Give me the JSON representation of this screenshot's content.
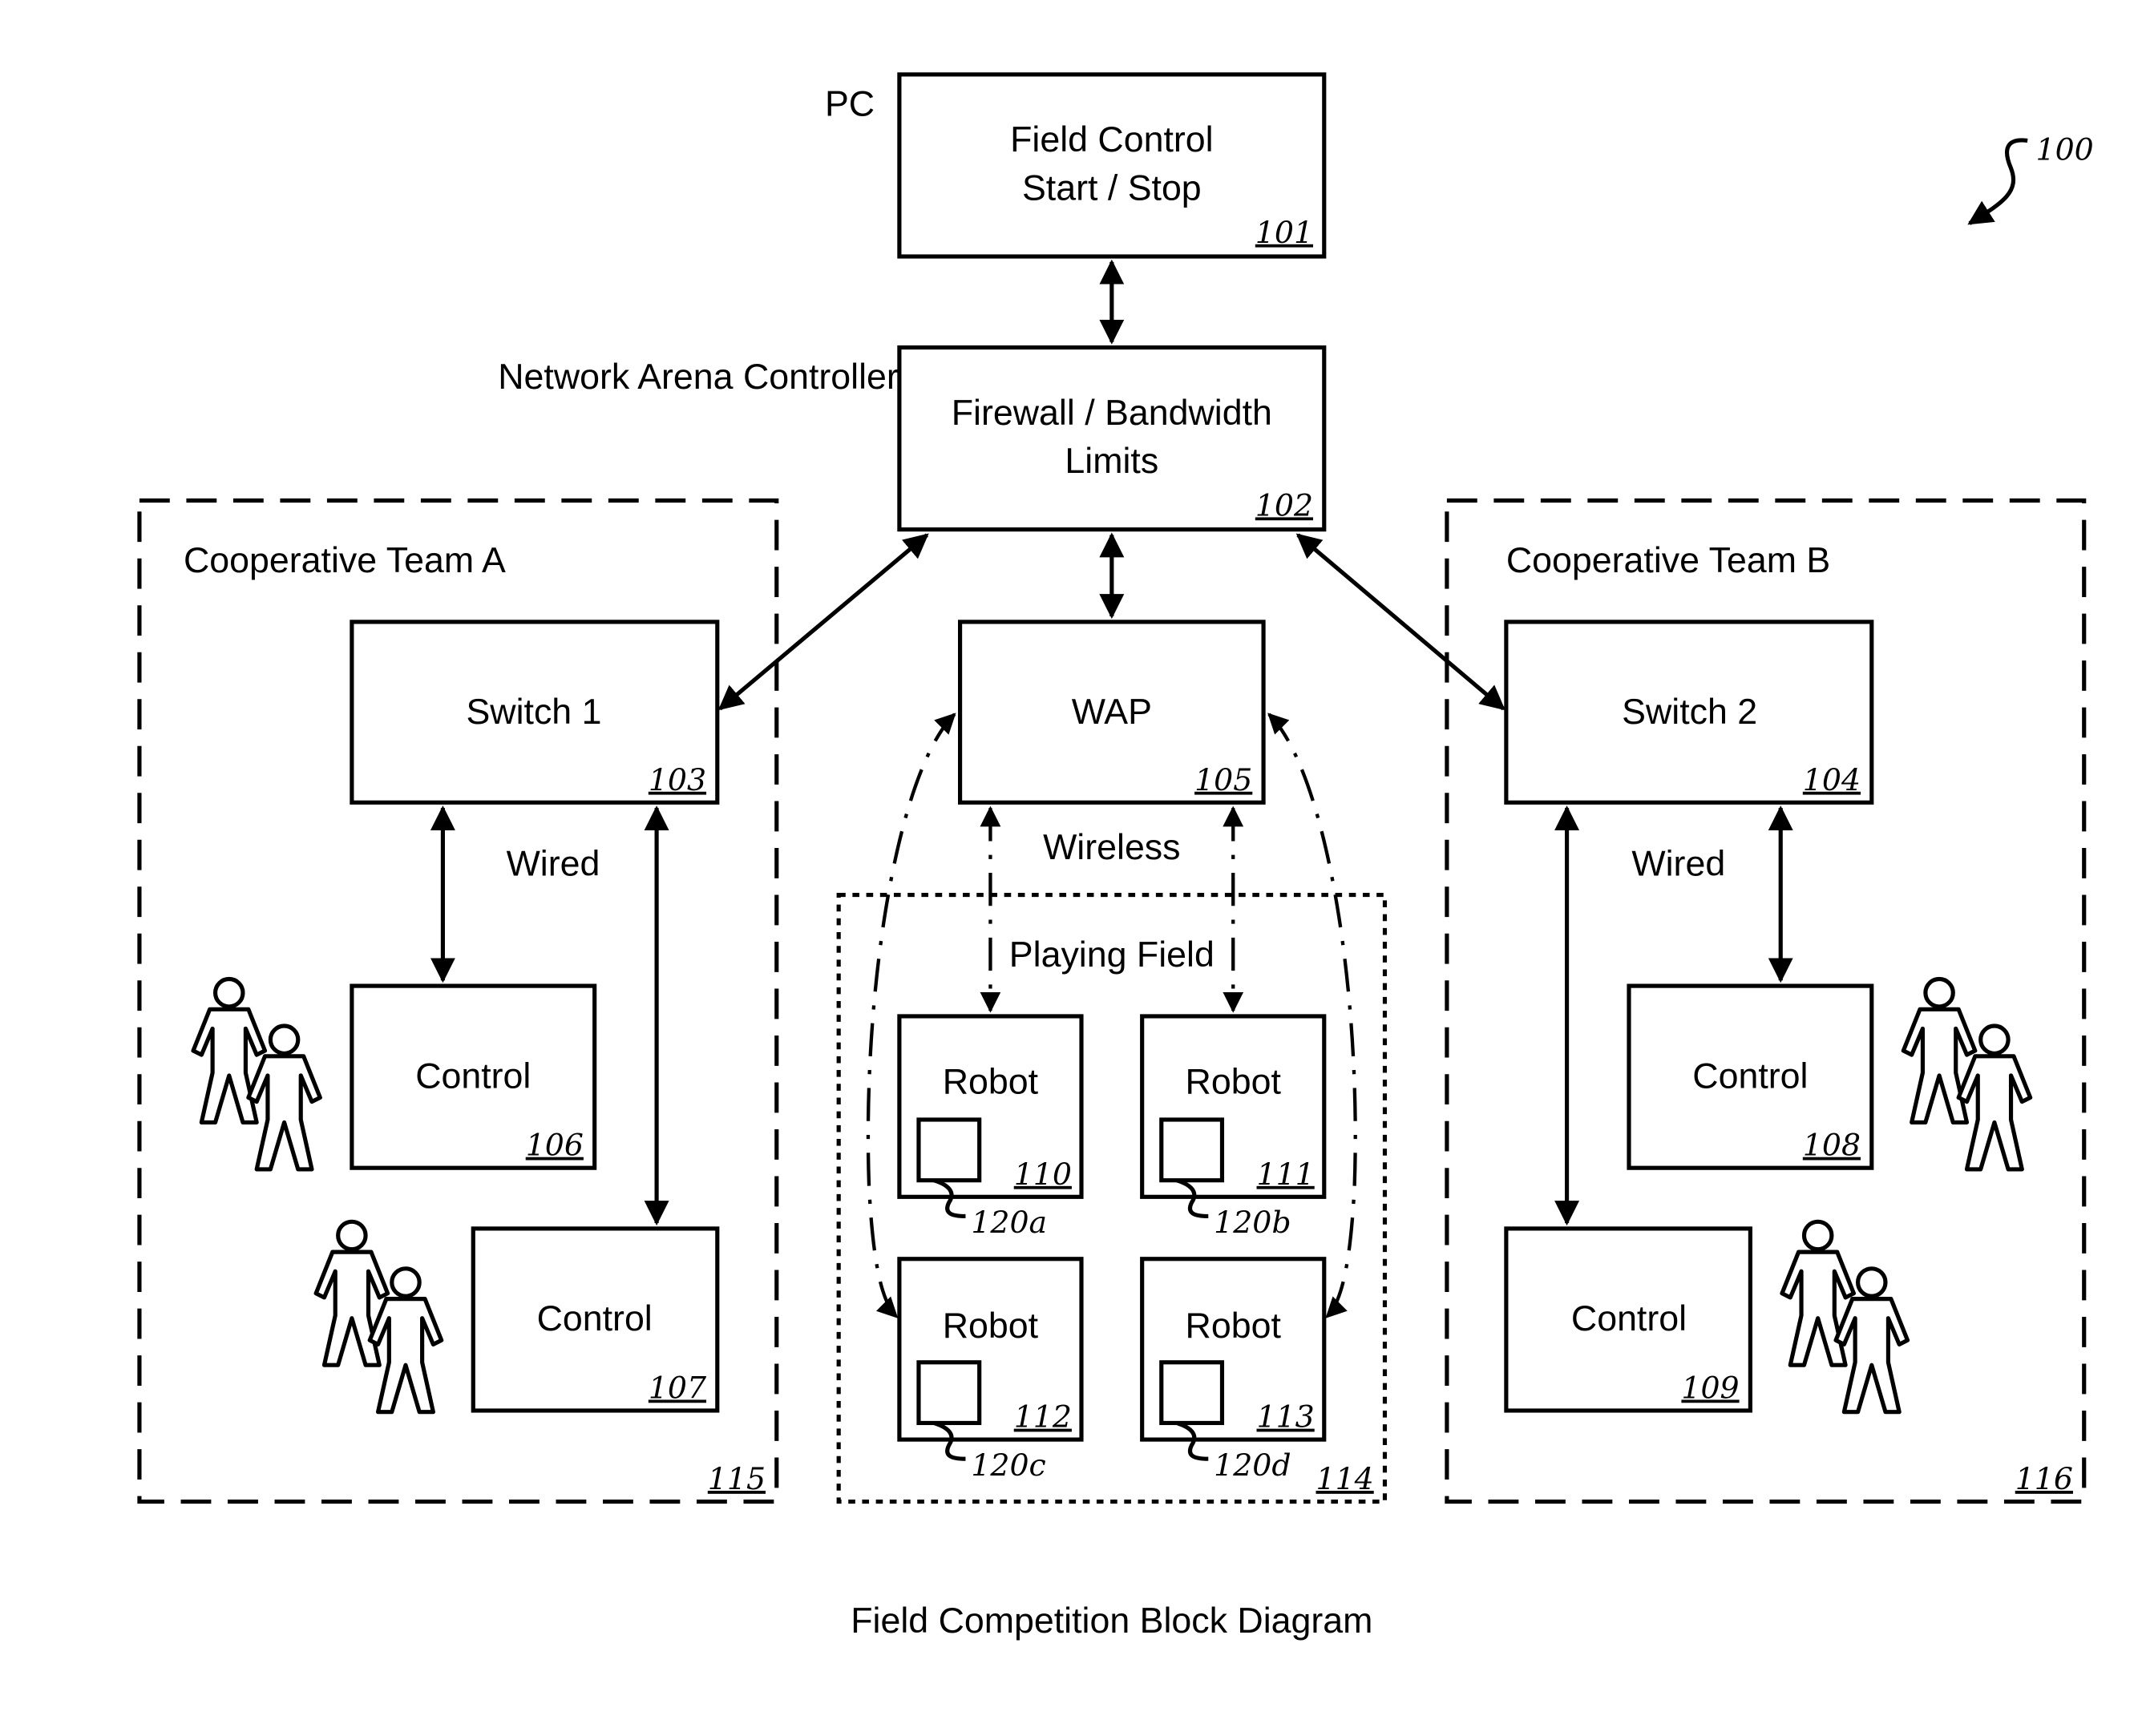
{
  "figure": {
    "ref_label": "100",
    "caption": "Field Competition Block Diagram"
  },
  "nodes": {
    "pc": {
      "side_label": "PC",
      "line1": "Field Control",
      "line2": "Start / Stop",
      "ref": "101"
    },
    "nac": {
      "side_label": "Network Arena Controller",
      "line1": "Firewall / Bandwidth",
      "line2": "Limits",
      "ref": "102"
    },
    "switch1": {
      "label": "Switch 1",
      "ref": "103"
    },
    "switch2": {
      "label": "Switch 2",
      "ref": "104"
    },
    "wap": {
      "label": "WAP",
      "ref": "105"
    },
    "control106": {
      "label": "Control",
      "ref": "106"
    },
    "control107": {
      "label": "Control",
      "ref": "107"
    },
    "control108": {
      "label": "Control",
      "ref": "108"
    },
    "control109": {
      "label": "Control",
      "ref": "109"
    },
    "robot110": {
      "label": "Robot",
      "ref": "110",
      "inner_ref": "120a"
    },
    "robot111": {
      "label": "Robot",
      "ref": "111",
      "inner_ref": "120b"
    },
    "robot112": {
      "label": "Robot",
      "ref": "112",
      "inner_ref": "120c"
    },
    "robot113": {
      "label": "Robot",
      "ref": "113",
      "inner_ref": "120d"
    }
  },
  "groups": {
    "team_a": {
      "label": "Cooperative Team A",
      "ref": "115",
      "link_label": "Wired"
    },
    "team_b": {
      "label": "Cooperative Team B",
      "ref": "116",
      "link_label": "Wired"
    },
    "field": {
      "label": "Playing Field",
      "ref": "114",
      "link_label": "Wireless"
    }
  }
}
